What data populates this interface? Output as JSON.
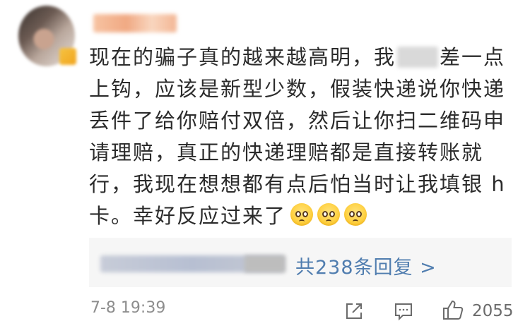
{
  "comment": {
    "lines": [
      {
        "before": "现在的骗子真的越来越高明，我",
        "after": "差一点"
      },
      {
        "text": "上钩，应该是新型少数，假装快递说你快递"
      },
      {
        "text": "丢件了给你赔付双倍，然后让你扫二维码申"
      },
      {
        "text": "请理赔，真正的快递理赔都是直接转账就"
      },
      {
        "text": "行，我现在想想都有点后怕当时让我填银 h"
      },
      {
        "text": "卡。幸好反应过来了"
      }
    ],
    "emoji_names": [
      "pleading-face-icon",
      "pleading-face-icon",
      "pleading-face-icon"
    ],
    "reply_summary": "共238条回复 >",
    "timestamp": "7-8 19:39",
    "likes": "2055"
  },
  "colors": {
    "text": "#2b2b2b",
    "link": "#507daf",
    "meta": "#8d8d8d",
    "reply_bg": "#f6f6f6"
  }
}
